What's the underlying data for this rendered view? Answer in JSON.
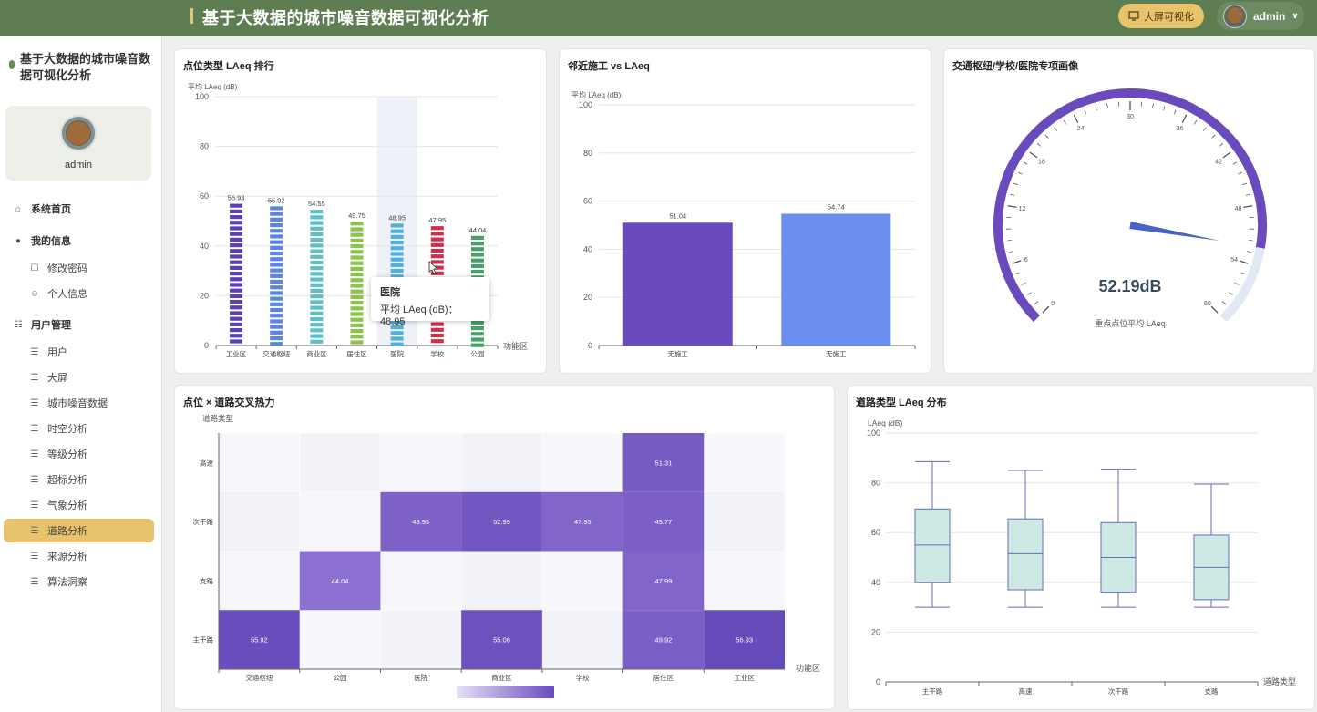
{
  "app": {
    "title": "基于大数据的城市噪音数据可视化分析",
    "bigscreen_label": "大屏可视化",
    "user": "admin"
  },
  "sidebar": {
    "title": "基于大数据的城市噪音数据可视化分析",
    "profile_name": "admin",
    "items": [
      {
        "label": "系统首页",
        "level": 1,
        "icon": "home-icon"
      },
      {
        "label": "我的信息",
        "level": 1,
        "icon": "user-icon"
      },
      {
        "label": "修改密码",
        "level": 2,
        "icon": "lock-icon"
      },
      {
        "label": "个人信息",
        "level": 2,
        "icon": "person-icon"
      },
      {
        "label": "用户管理",
        "level": 1,
        "icon": "chart-board-icon"
      },
      {
        "label": "用户",
        "level": 2,
        "icon": "doc-icon"
      },
      {
        "label": "大屏",
        "level": 2,
        "icon": "doc-icon"
      },
      {
        "label": "城市噪音数据",
        "level": 2,
        "icon": "doc-icon"
      },
      {
        "label": "时空分析",
        "level": 2,
        "icon": "doc-icon"
      },
      {
        "label": "等级分析",
        "level": 2,
        "icon": "doc-icon"
      },
      {
        "label": "超标分析",
        "level": 2,
        "icon": "doc-icon"
      },
      {
        "label": "气象分析",
        "level": 2,
        "icon": "doc-icon"
      },
      {
        "label": "道路分析",
        "level": 2,
        "icon": "doc-icon",
        "active": true
      },
      {
        "label": "来源分析",
        "level": 2,
        "icon": "doc-icon"
      },
      {
        "label": "算法洞察",
        "level": 2,
        "icon": "doc-icon"
      }
    ]
  },
  "cards": {
    "rank_title": "点位类型 LAeq 排行",
    "construction_title": "邻近施工 vs LAeq",
    "gauge_title": "交通枢纽/学校/医院专项画像",
    "heatmap_title": "点位 × 道路交叉热力",
    "box_title": "道路类型 LAeq 分布"
  },
  "tooltip": {
    "title": "医院",
    "label": "平均 LAeq (dB)：",
    "value": "48.95"
  },
  "chart_data": [
    {
      "type": "bar",
      "title": "点位类型 LAeq 排行",
      "ylabel": "平均 LAeq (dB)",
      "xlabel": "功能区",
      "ylim": [
        0,
        100
      ],
      "yticks": [
        0,
        20,
        40,
        60,
        80,
        100
      ],
      "categories": [
        "工业区",
        "交通枢纽",
        "商业区",
        "居住区",
        "医院",
        "学校",
        "公园"
      ],
      "values": [
        56.93,
        55.92,
        54.55,
        49.75,
        48.95,
        47.95,
        44.04
      ],
      "labels": [
        "56.93",
        "55.92",
        "54.55",
        "49.75",
        "48.95",
        "47.95",
        "44.04"
      ],
      "colors": [
        "#5b40b0",
        "#5c83e6",
        "#5fbfc4",
        "#8cc34a",
        "#4fb2dc",
        "#c8334f",
        "#47a06a"
      ]
    },
    {
      "type": "bar",
      "title": "邻近施工 vs LAeq",
      "ylabel": "平均 LAeq (dB)",
      "ylim": [
        0,
        100
      ],
      "yticks": [
        0,
        20,
        40,
        60,
        80,
        100
      ],
      "categories": [
        "无施工",
        "无施工"
      ],
      "values": [
        51.04,
        54.74
      ],
      "labels": [
        "51.04",
        "54.74"
      ],
      "colors": [
        "#6a4bbd",
        "#6b8ef0"
      ]
    },
    {
      "type": "gauge",
      "title": "交通枢纽/学校/医院专项画像",
      "min": 0,
      "max": 60,
      "value": 52.19,
      "display": "52.19dB",
      "subtitle": "重点点位平均 LAeq",
      "ticks": [
        "0",
        "6",
        "12",
        "18",
        "24",
        "30",
        "36",
        "42",
        "48",
        "54",
        "60"
      ]
    },
    {
      "type": "heatmap",
      "title": "点位 × 道路交叉热力",
      "ylabel": "道路类型",
      "xlabel": "功能区",
      "x": [
        "交通枢纽",
        "公园",
        "医院",
        "商业区",
        "学校",
        "居住区",
        "工业区"
      ],
      "y": [
        "主干路",
        "支路",
        "次干路",
        "高速"
      ],
      "cells": [
        {
          "x": "交通枢纽",
          "y": "主干路",
          "value": 55.92
        },
        {
          "x": "商业区",
          "y": "主干路",
          "value": 55.06
        },
        {
          "x": "居住区",
          "y": "主干路",
          "value": 49.92
        },
        {
          "x": "工业区",
          "y": "主干路",
          "value": 56.93
        },
        {
          "x": "公园",
          "y": "支路",
          "value": 44.04
        },
        {
          "x": "居住区",
          "y": "支路",
          "value": 47.99
        },
        {
          "x": "医院",
          "y": "次干路",
          "value": 48.95
        },
        {
          "x": "商业区",
          "y": "次干路",
          "value": 52.99
        },
        {
          "x": "学校",
          "y": "次干路",
          "value": 47.95
        },
        {
          "x": "居住区",
          "y": "次干路",
          "value": 49.77
        },
        {
          "x": "居住区",
          "y": "高速",
          "value": 51.31
        }
      ]
    },
    {
      "type": "box",
      "title": "道路类型 LAeq 分布",
      "ylabel": "LAeq (dB)",
      "xlabel": "道路类型",
      "ylim": [
        0,
        100
      ],
      "yticks": [
        0,
        20,
        40,
        60,
        80,
        100
      ],
      "categories": [
        "主干路",
        "高速",
        "次干路",
        "支路"
      ],
      "boxes": [
        {
          "min": 30,
          "q1": 40,
          "median": 55,
          "q3": 69.5,
          "max": 88.5
        },
        {
          "min": 30,
          "q1": 37,
          "median": 51.5,
          "q3": 65.5,
          "max": 85
        },
        {
          "min": 30,
          "q1": 36,
          "median": 50,
          "q3": 64,
          "max": 85.5
        },
        {
          "min": 30,
          "q1": 33,
          "median": 46,
          "q3": 59,
          "max": 79.5
        }
      ]
    }
  ]
}
